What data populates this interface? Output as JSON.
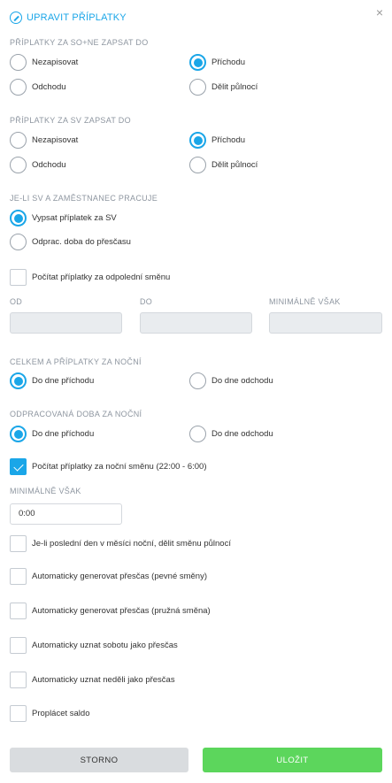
{
  "dialog": {
    "title": "UPRAVIT PŘÍPLATKY",
    "close_symbol": "×"
  },
  "section_sone": {
    "label": "PŘÍPLATKY ZA SO+NE ZAPSAT DO",
    "options": [
      "Nezapisovat",
      "Příchodu",
      "Odchodu",
      "Dělit půlnocí"
    ],
    "selected": "Příchodu"
  },
  "section_sv": {
    "label": "PŘÍPLATKY ZA SV ZAPSAT DO",
    "options": [
      "Nezapisovat",
      "Příchodu",
      "Odchodu",
      "Dělit půlnocí"
    ],
    "selected": "Příchodu"
  },
  "section_works": {
    "label": "JE-LI SV A ZAMĚSTNANEC PRACUJE",
    "options": [
      "Vypsat příplatek za SV",
      "Odprac. doba do přesčasu"
    ],
    "selected": "Vypsat příplatek za SV"
  },
  "afternoon": {
    "label": "Počítat příplatky za odpolední směnu",
    "checked": false,
    "od_label": "OD",
    "do_label": "DO",
    "min_label": "MINIMÁLNĚ VŠAK"
  },
  "section_total_night": {
    "label": "CELKEM A PŘÍPLATKY ZA NOČNÍ",
    "options": [
      "Do dne příchodu",
      "Do dne odchodu"
    ],
    "selected": "Do dne příchodu"
  },
  "section_worked_night": {
    "label": "ODPRACOVANÁ DOBA ZA NOČNÍ",
    "options": [
      "Do dne příchodu",
      "Do dne odchodu"
    ],
    "selected": "Do dne příchodu"
  },
  "night": {
    "label": "Počítat příplatky za noční směnu (22:00 - 6:00)",
    "checked": true,
    "min_label": "MINIMÁLNĚ VŠAK",
    "min_value": "0:00"
  },
  "checkboxes": [
    {
      "label": "Je-li poslední den v měsíci noční, dělit směnu půlnocí",
      "checked": false
    },
    {
      "label": "Automaticky generovat přesčas (pevné směny)",
      "checked": false
    },
    {
      "label": "Automaticky generovat přesčas (pružná směna)",
      "checked": false
    },
    {
      "label": "Automaticky uznat sobotu jako přesčas",
      "checked": false
    },
    {
      "label": "Automaticky uznat neděli jako přesčas",
      "checked": false
    },
    {
      "label": "Proplácet saldo",
      "checked": false
    }
  ],
  "buttons": {
    "cancel": "STORNO",
    "save": "ULOŽIT"
  },
  "colors": {
    "accent": "#1aa6e8",
    "save": "#5cd65c",
    "cancel": "#d9dcdf",
    "muted_label": "#8e96a0"
  }
}
